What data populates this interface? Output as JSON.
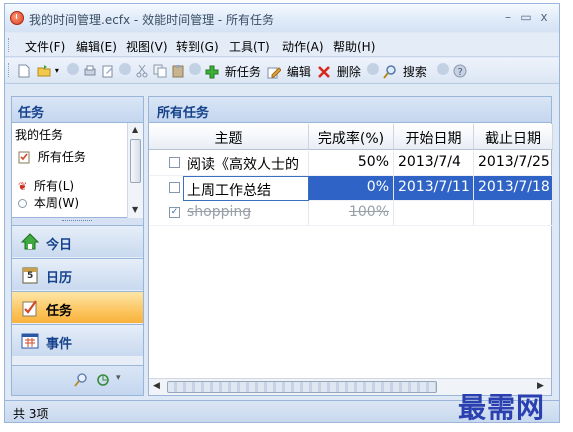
{
  "window": {
    "title": "我的时间管理.ecfx - 效能时间管理 - 所有任务",
    "controls": {
      "minimize": "–",
      "maximize": "▭",
      "close": "x"
    }
  },
  "menu": {
    "items": [
      "文件(F)",
      "编辑(E)",
      "视图(V)",
      "转到(G)",
      "工具(T)",
      "动作(A)",
      "帮助(H)"
    ]
  },
  "toolbar": {
    "new_task_label": "新任务",
    "edit_label": "编辑",
    "delete_label": "删除",
    "search_label": "搜索"
  },
  "left_panel": {
    "title": "任务",
    "list": [
      {
        "label": "我的任务"
      },
      {
        "label": "所有任务"
      },
      {
        "label": "所有(L)"
      },
      {
        "label": "本周(W)"
      }
    ],
    "nav": [
      {
        "label": "今日",
        "icon": "today-icon"
      },
      {
        "label": "日历",
        "icon": "calendar-icon",
        "calendar_number": "5"
      },
      {
        "label": "任务",
        "icon": "task-icon",
        "active": true
      },
      {
        "label": "事件",
        "icon": "event-icon"
      }
    ]
  },
  "main": {
    "title": "所有任务",
    "columns": [
      "主题",
      "完成率(%)",
      "开始日期",
      "截止日期"
    ],
    "rows": [
      {
        "subject": "阅读《高效人士的",
        "percent": "50%",
        "start": "2013/7/4",
        "due": "2013/7/25",
        "checked": false,
        "completed": false,
        "selected": false
      },
      {
        "subject": "上周工作总结",
        "percent": "0%",
        "start": "2013/7/11",
        "due": "2013/7/18",
        "checked": false,
        "completed": false,
        "selected": true
      },
      {
        "subject": "shopping",
        "percent": "100%",
        "start": "",
        "due": "",
        "checked": true,
        "completed": true,
        "selected": false
      }
    ],
    "checked_mark": "✓"
  },
  "status": {
    "text": "共 3项"
  },
  "watermark": "最需网"
}
